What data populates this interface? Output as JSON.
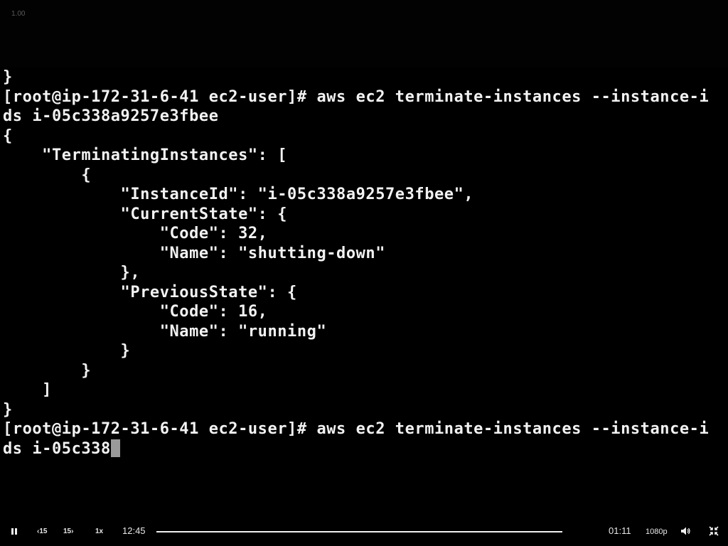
{
  "player": {
    "speed_indicator": "1.00",
    "rewind_label": "15",
    "forward_label": "15",
    "playback_rate": "1x",
    "time_current": "12:45",
    "time_remaining": "01:11",
    "quality": "1080p",
    "progress_fraction": 1.0,
    "icons": {
      "pause": "pause-icon",
      "rewind": "rewind-15-icon",
      "forward": "forward-15-icon",
      "volume": "volume-icon",
      "fullscreen": "exit-fullscreen-icon"
    }
  },
  "terminal": {
    "lines": [
      "}",
      "[root@ip-172-31-6-41 ec2-user]# aws ec2 terminate-instances --instance-i",
      "ds i-05c338a9257e3fbee",
      "{",
      "    \"TerminatingInstances\": [",
      "        {",
      "            \"InstanceId\": \"i-05c338a9257e3fbee\",",
      "            \"CurrentState\": {",
      "                \"Code\": 32,",
      "                \"Name\": \"shutting-down\"",
      "            },",
      "            \"PreviousState\": {",
      "                \"Code\": 16,",
      "                \"Name\": \"running\"",
      "            }",
      "        }",
      "    ]",
      "}",
      "[root@ip-172-31-6-41 ec2-user]# aws ec2 terminate-instances --instance-i",
      "ds i-05c338"
    ],
    "cursor_line": 19
  }
}
